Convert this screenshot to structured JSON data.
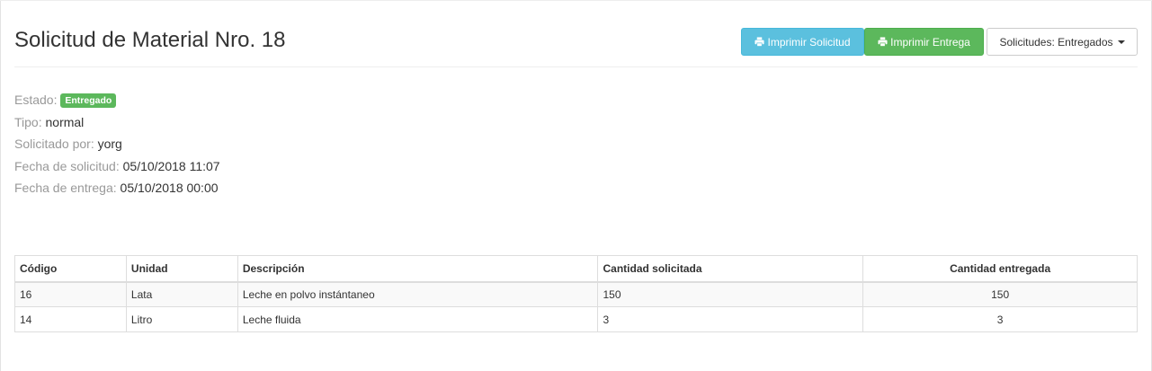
{
  "header": {
    "title": "Solicitud de Material Nro. 18",
    "buttons": {
      "print_request": "Imprimir Solicitud",
      "print_delivery": "Imprimir Entrega",
      "dropdown": "Solicitudes: Entregados"
    }
  },
  "details": {
    "status_label": "Estado:",
    "status_value": "Entregado",
    "type_label": "Tipo:",
    "type_value": "normal",
    "requested_by_label": "Solicitado por:",
    "requested_by_value": "yorg",
    "request_date_label": "Fecha de solicitud:",
    "request_date_value": "05/10/2018 11:07",
    "delivery_date_label": "Fecha de entrega:",
    "delivery_date_value": "05/10/2018 00:00"
  },
  "table": {
    "columns": [
      "Código",
      "Unidad",
      "Descripción",
      "Cantidad solicitada",
      "Cantidad entregada"
    ],
    "rows": [
      [
        "16",
        "Lata",
        "Leche en polvo instántaneo",
        "150",
        "150"
      ],
      [
        "14",
        "Litro",
        "Leche fluida",
        "3",
        "3"
      ]
    ]
  },
  "colors": {
    "info": "#5bc0de",
    "success": "#5cb85c",
    "label": "#999999"
  },
  "icons": {
    "print": "print-icon",
    "caret": "caret-down-icon"
  }
}
